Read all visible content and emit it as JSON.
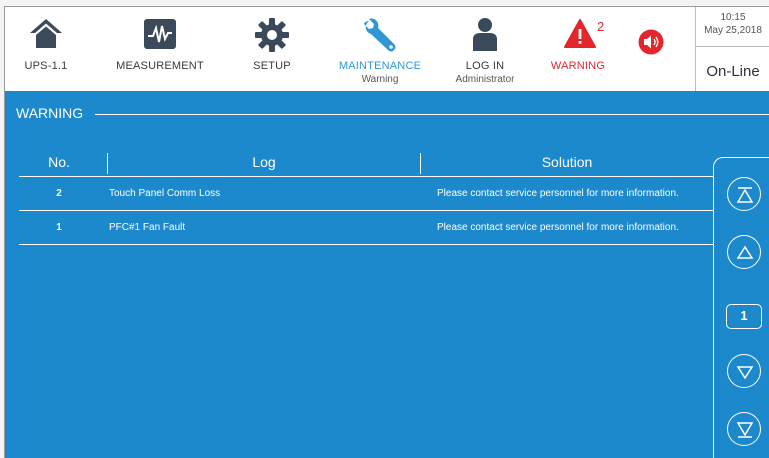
{
  "nav": {
    "ups": {
      "label": "UPS-1.1",
      "icon": "home-icon"
    },
    "measurement": {
      "label": "MEASUREMENT",
      "icon": "waveform-icon"
    },
    "setup": {
      "label": "SETUP",
      "icon": "gear-icon"
    },
    "maintenance": {
      "label": "MAINTENANCE",
      "sub": "Warning",
      "icon": "wrench-icon"
    },
    "login": {
      "label": "LOG IN",
      "sub": "Administrator",
      "icon": "user-icon"
    },
    "warning": {
      "label": "WARNING",
      "count": "2",
      "icon": "warning-triangle-icon"
    },
    "alarm": {
      "icon": "speaker-alarm-icon"
    }
  },
  "clock": {
    "time": "10:15",
    "date": "May 25,2018"
  },
  "status": "On-Line",
  "section": {
    "title": "WARNING"
  },
  "table": {
    "headers": {
      "no": "No.",
      "log": "Log",
      "solution": "Solution"
    },
    "rows": [
      {
        "no": "2",
        "log": "Touch Panel Comm Loss",
        "solution": "Please contact service personnel for more information."
      },
      {
        "no": "1",
        "log": "PFC#1 Fan Fault",
        "solution": "Please contact service personnel for more information."
      }
    ]
  },
  "pager": {
    "page": "1"
  },
  "colors": {
    "accent": "#2f97d6",
    "panel": "#1c89cc",
    "warning": "#e2262c",
    "icon": "#3a4a5a"
  }
}
